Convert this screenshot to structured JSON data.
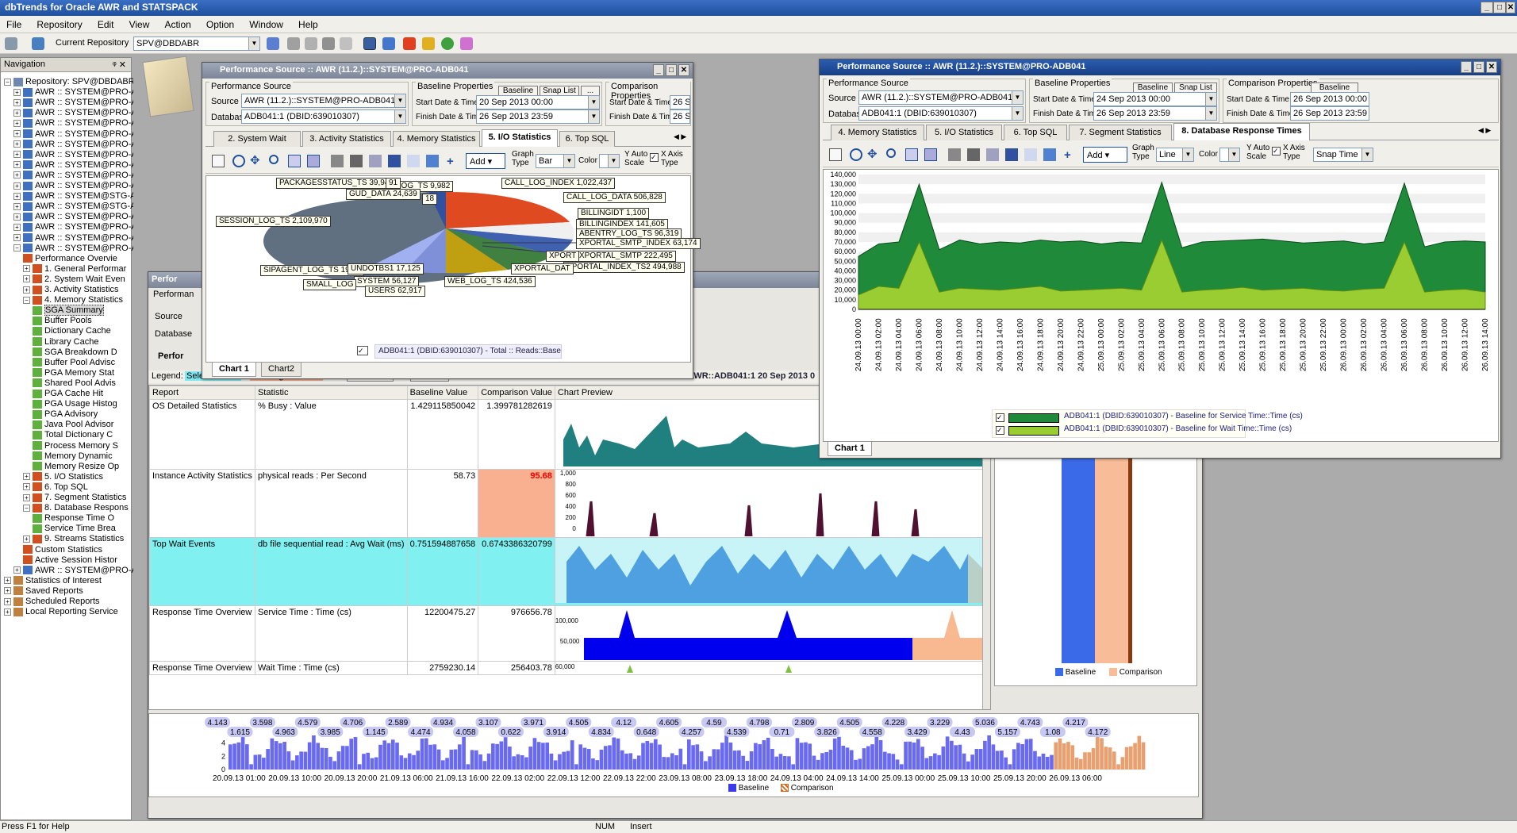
{
  "app": {
    "title": "dbTrends for Oracle AWR and STATSPACK"
  },
  "menu": [
    "File",
    "Repository",
    "Edit",
    "View",
    "Action",
    "Option",
    "Window",
    "Help"
  ],
  "toolbar": {
    "current_repository_label": "Current Repository",
    "current_repository_value": "SPV@DBDABR"
  },
  "nav": {
    "header": "Navigation",
    "pin": "ᵠ ✕",
    "root": "Repository: SPV@DBDABR",
    "awr_items": [
      "AWR :: SYSTEM@PRO-A",
      "AWR :: SYSTEM@PRO-A",
      "AWR :: SYSTEM@PRO-A",
      "AWR :: SYSTEM@PRO-A",
      "AWR :: SYSTEM@PRO-A",
      "AWR :: SYSTEM@PRO-A",
      "AWR :: SYSTEM@PRO-A",
      "AWR :: SYSTEM@PRO-A",
      "AWR :: SYSTEM@PRO-A",
      "AWR :: SYSTEM@PRO-A",
      "AWR :: SYSTEM@STG-A",
      "AWR :: SYSTEM@STG-A",
      "AWR :: SYSTEM@PRO-A",
      "AWR :: SYSTEM@PRO-A",
      "AWR :: SYSTEM@PRO-A",
      "AWR :: SYSTEM@PRO-A"
    ],
    "sub_items": [
      "Performance Overvie",
      "1. General Performar",
      "2. System Wait Even",
      "3. Activity Statistics",
      "4. Memory Statistics"
    ],
    "mem_items": [
      "SGA Summary",
      "Buffer Pools",
      "Dictionary Cache",
      "Library Cache",
      "SGA Breakdown D",
      "Buffer Pool Advisc",
      "PGA Memory Stat",
      "Shared Pool Advis",
      "PGA Cache Hit",
      "PGA Usage Histog",
      "PGA Advisory",
      "Java Pool Advisor",
      "Total Dictionary C",
      "Process Memory S",
      "Memory Dynamic",
      "Memory Resize Op"
    ],
    "after_items": [
      "5. I/O Statistics",
      "6. Top SQL",
      "7. Segment Statistics",
      "8. Database Respons"
    ],
    "db_items": [
      "Response Time O",
      "Service Time Brea"
    ],
    "tail_items": [
      "9. Streams Statistics",
      "Custom Statistics",
      "Active Session Histor"
    ],
    "root_tail": [
      "AWR :: SYSTEM@PRO-A",
      "Statistics of Interest",
      "Saved Reports",
      "Scheduled Reports",
      "Local Reporting Service"
    ]
  },
  "win1": {
    "title": "Performance Source :: AWR (11.2.)::SYSTEM@PRO-ADB041",
    "perf_source_legend": "Performance Source",
    "source_label": "Source",
    "source_value": "AWR (11.2.)::SYSTEM@PRO-ADB041",
    "db_label": "Database",
    "db_value": "ADB041:1 (DBID:639010307)",
    "baseline_legend": "Baseline Properties",
    "baseline_btn": "Baseline",
    "snaplist_btn": "Snap List",
    "more_btn": "...",
    "start_label": "Start Date & Time",
    "start_value": "20 Sep 2013 00:00",
    "finish_label": "Finish Date & Time",
    "finish_value": "26 Sep 2013 23:59",
    "comp_legend": "Comparison Properties",
    "comp_start_label": "Start Date & Time",
    "comp_start_value": "26 Se",
    "comp_finish_label": "Finish Date & Time",
    "comp_finish_value": "26 Se",
    "tabs": [
      "2. System Wait Events",
      "3. Activity Statistics",
      "4. Memory Statistics",
      "5. I/O Statistics",
      "6. Top SQL"
    ],
    "graph_type_label": "Graph Type",
    "graph_type_value": "Bar",
    "color_label": "Color",
    "yauto_label": "Y Auto Scale",
    "xaxis_label": "X Axis Type",
    "add_btn": "Add",
    "legend_text": "ADB041:1 (DBID:639010307) - Total :: Reads::Baseline",
    "chart_tabs": [
      "Chart 1",
      "Chart2"
    ],
    "pie_labels": [
      "PACKAGESSTATUS_TS 39,949",
      "LOG_TS 9,982",
      "GUD_DATA 24,639",
      "CALL_LOG_INDEX 1,022,437",
      "CALL_LOG_DATA 506,828",
      "SESSION_LOG_TS 2,109,970",
      "BILLINGINDEX 141,605",
      "ABENTRY_LOG_TS 96,319",
      "XPORTAL_SMTP_INDEX 63,174",
      "XPORTAL_SMTP 222,495",
      "XPORTAL_INDEX_TS2 494,988",
      "SIPAGENT_LOG_TS 193,5",
      "UNDOTBS1 17,125",
      "SYSTEM 56,127",
      "USERS 62,917",
      "SMALL_LOG",
      "WEB_LOG_TS 424,536",
      "XPORTAL_DAT",
      "XPORT"
    ],
    "pie_frag": [
      "91",
      "18",
      "BILLINGIDT 1,100"
    ]
  },
  "win2": {
    "title": "Performance Source :: AWR (11.2.)::SYSTEM@PRO-ADB041",
    "perf_source_legend": "Performance Source",
    "source_label": "Source",
    "source_value": "AWR (11.2.)::SYSTEM@PRO-ADB041",
    "db_label": "Database",
    "db_value": "ADB041:1 (DBID:639010307)",
    "baseline_legend": "Baseline Properties",
    "baseline_btn": "Baseline",
    "snaplist_btn": "Snap List",
    "start_label": "Start Date & Time",
    "start_value": "24 Sep 2013 00:00",
    "finish_label": "Finish Date & Time",
    "finish_value": "26 Sep 2013 23:59",
    "comp_legend": "Comparison Properties",
    "comp_baseline_btn": "Baseline",
    "comp_start_label": "Start Date & Time",
    "comp_start_value": "26 Sep 2013 00:00",
    "comp_finish_label": "Finish Date & Time",
    "comp_finish_value": "26 Sep 2013 23:59",
    "tabs": [
      "4. Memory Statistics",
      "5. I/O Statistics",
      "6. Top SQL",
      "7. Segment Statistics",
      "8. Database Response Times"
    ],
    "graph_type_label": "Graph Type",
    "graph_type_value": "Line",
    "color_label": "Color",
    "yauto_label": "Y Auto Scale",
    "xaxis_label": "X Axis Type",
    "xaxis_value": "Snap Time",
    "add_btn": "Add",
    "legend1": "ADB041:1 (DBID:639010307) - Baseline for Service Time::Time (cs)",
    "legend2": "ADB041:1 (DBID:639010307) - Baseline for Wait Time::Time (cs)",
    "chart_tab": "Chart 1"
  },
  "bgwin": {
    "title": "Perfor",
    "perf_label": "Performan",
    "source_label": "Source",
    "db_label": "Database",
    "perf_tab": "Perfor",
    "legend_label": "Legend:",
    "selected_item": "Selected item",
    "warning_stats": "Warning Statistics",
    "remove_btn": "Remove",
    "edit_btn": "Edit",
    "header_title": "AWR::ADB041:1 20 Sep 2013 0",
    "columns": [
      "Report",
      "Statistic",
      "Baseline Value",
      "Comparison Value",
      "Chart Preview"
    ],
    "rows": [
      {
        "report": "OS Detailed Statistics",
        "statistic": "% Busy : Value",
        "baseline": "1.429115850042",
        "comparison": "1.399781282619"
      },
      {
        "report": "Instance Activity Statistics",
        "statistic": "physical reads : Per Second",
        "baseline": "58.73",
        "comparison": "95.68"
      },
      {
        "report": "Top Wait Events",
        "statistic": "db file sequential read : Avg Wait (ms)",
        "baseline": "0.751594887658",
        "comparison": "0.6743386320799"
      },
      {
        "report": "Response Time Overview",
        "statistic": "Service Time : Time (cs)",
        "baseline": "12200475.27",
        "comparison": "976656.78"
      },
      {
        "report": "Response Time Overview",
        "statistic": "Wait Time : Time (cs)",
        "baseline": "2759230.14",
        "comparison": "256403.78"
      }
    ],
    "mini_ticks_inst": [
      "1,000",
      "800",
      "600",
      "400",
      "200",
      "0"
    ],
    "mini_ticks_rt": [
      "100,000",
      "50,000"
    ],
    "mini_tick_wt": "60,000",
    "bar_legend": [
      "Baseline",
      "Comparison"
    ],
    "bottom_legend": [
      "Baseline",
      "Comparison"
    ]
  },
  "chart_data": [
    {
      "type": "area",
      "title": "",
      "ylabel": "",
      "ylim": [
        0,
        140000
      ],
      "yticks": [
        "140,000",
        "130,000",
        "120,000",
        "110,000",
        "100,000",
        "90,000",
        "80,000",
        "70,000",
        "60,000",
        "50,000",
        "40,000",
        "30,000",
        "20,000",
        "10,000",
        "0"
      ],
      "x": [
        "24.09.13 00:00",
        "24.09.13 02:00",
        "24.09.13 04:00",
        "24.09.13 06:00",
        "24.09.13 08:00",
        "24.09.13 10:00",
        "24.09.13 12:00",
        "24.09.13 14:00",
        "24.09.13 16:00",
        "24.09.13 18:00",
        "24.09.13 20:00",
        "24.09.13 22:00",
        "25.09.13 00:00",
        "25.09.13 02:00",
        "25.09.13 04:00",
        "25.09.13 06:00",
        "25.09.13 08:00",
        "25.09.13 10:00",
        "25.09.13 12:00",
        "25.09.13 14:00",
        "25.09.13 16:00",
        "25.09.13 18:00",
        "25.09.13 20:00",
        "25.09.13 22:00",
        "26.09.13 00:00",
        "26.09.13 02:00",
        "26.09.13 04:00",
        "26.09.13 06:00",
        "26.09.13 08:00",
        "26.09.13 10:00",
        "26.09.13 12:00",
        "26.09.13 14:00"
      ],
      "series": [
        {
          "name": "ADB041:1 (DBID:639010307) - Baseline for Service Time::Time (cs)",
          "color": "#1E8A3A",
          "values": [
            55000,
            68000,
            70000,
            130000,
            62000,
            72000,
            68000,
            70000,
            69000,
            72000,
            70000,
            71000,
            68000,
            70000,
            69000,
            132000,
            64000,
            70000,
            71000,
            72000,
            73000,
            71000,
            69000,
            70000,
            71000,
            68000,
            70000,
            131000,
            65000,
            70000,
            71000,
            70000
          ]
        },
        {
          "name": "ADB041:1 (DBID:639010307) - Baseline for Wait Time::Time (cs)",
          "color": "#9ACD32",
          "values": [
            15000,
            24000,
            22000,
            70000,
            18000,
            22000,
            21000,
            20000,
            22000,
            24000,
            19000,
            20000,
            21000,
            22000,
            20000,
            72000,
            18000,
            20000,
            21000,
            23000,
            20000,
            21000,
            22000,
            20000,
            19000,
            21000,
            22000,
            70000,
            18000,
            20000,
            21000,
            18000
          ]
        }
      ]
    },
    {
      "type": "bar",
      "title": "",
      "ylabel": "",
      "ylim": [
        0,
        6
      ],
      "yticks": [
        "4",
        "2",
        "0"
      ],
      "x": [
        "20.09.13 01:00",
        "20.09.13 10:00",
        "20.09.13 20:00",
        "21.09.13 06:00",
        "21.09.13 16:00",
        "22.09.13 02:00",
        "22.09.13 12:00",
        "22.09.13 22:00",
        "23.09.13 08:00",
        "23.09.13 18:00",
        "24.09.13 04:00",
        "24.09.13 14:00",
        "25.09.13 00:00",
        "25.09.13 10:00",
        "25.09.13 20:00",
        "26.09.13 06:00"
      ],
      "labels": [
        "4.143",
        "1.615",
        "3.598",
        "4.963",
        "4.579",
        "3.985",
        "4.706",
        "1.145",
        "2.589",
        "4.474",
        "4.934",
        "4.058",
        "3.107",
        "0.622",
        "3.971",
        "3.914",
        "4.505",
        "4.834",
        "4.12",
        "0.648",
        "4.605",
        "4.257",
        "4.59",
        "4.539",
        "4.798",
        "0.71",
        "2.809",
        "3.826",
        "4.505",
        "4.558",
        "4.228",
        "3.429",
        "3.229",
        "4.43",
        "5.036",
        "5.157",
        "4.743",
        "1.08",
        "4.217",
        "4.172"
      ],
      "series": [
        {
          "name": "Baseline",
          "color": "#3A3AE8"
        },
        {
          "name": "Comparison",
          "color": "#D2691E"
        }
      ]
    }
  ],
  "status": {
    "help": "Press F1 for Help",
    "num": "NUM",
    "insert": "Insert"
  }
}
